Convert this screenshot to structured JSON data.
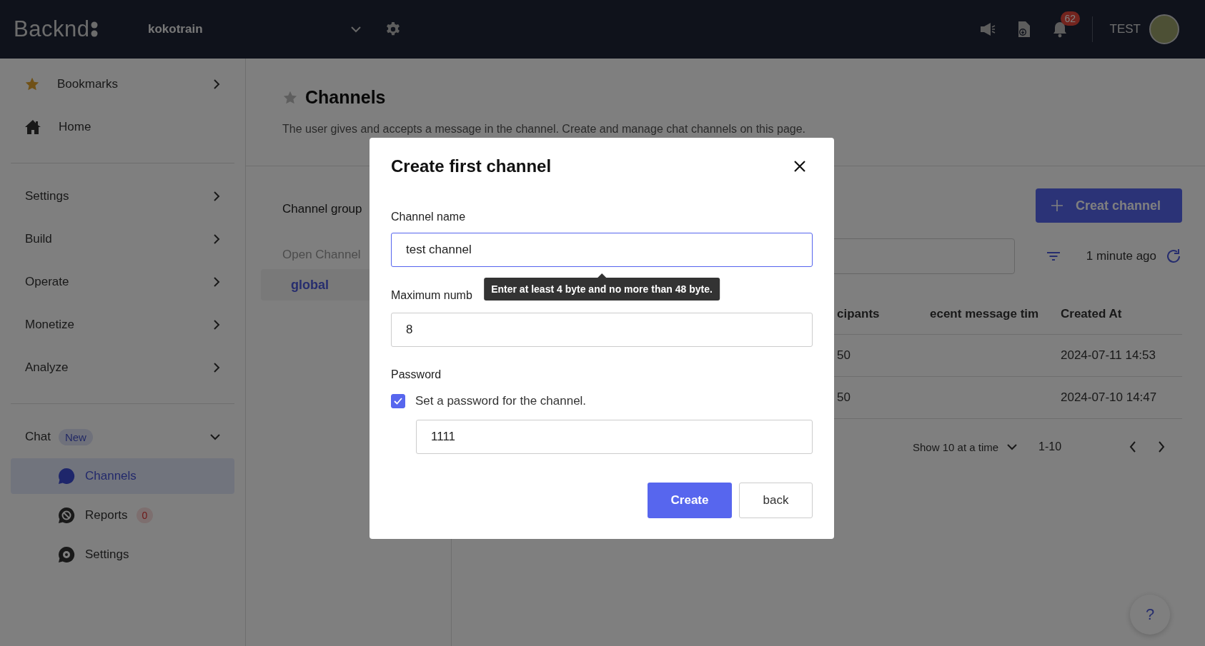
{
  "topbar": {
    "logo": "Backnd",
    "project": "kokotrain",
    "notification_count": "62",
    "user": "TEST"
  },
  "sidebar": {
    "groups": [
      {
        "items": [
          {
            "kind": "menu",
            "label": "Bookmarks",
            "expanded": false
          },
          {
            "kind": "link",
            "label": "Home"
          }
        ]
      },
      {
        "items": [
          {
            "kind": "menu",
            "label": "Settings",
            "expanded": false
          },
          {
            "kind": "menu",
            "label": "Build",
            "expanded": false
          },
          {
            "kind": "menu",
            "label": "Operate",
            "expanded": false
          },
          {
            "kind": "menu",
            "label": "Monetize",
            "expanded": false
          },
          {
            "kind": "menu",
            "label": "Analyze",
            "expanded": false
          }
        ]
      },
      {
        "items": [
          {
            "kind": "menu",
            "label": "Chat",
            "badge": "New",
            "expanded": true,
            "children": [
              {
                "label": "Channels",
                "selected": true
              },
              {
                "label": "Reports",
                "badge": "0",
                "selected": false
              },
              {
                "label": "Settings",
                "selected": false
              }
            ]
          }
        ]
      }
    ]
  },
  "page": {
    "title": "Channels",
    "description": "The user gives and accepts a message in the channel. Create and manage chat channels on this page."
  },
  "channel_groups": {
    "label": "Channel group",
    "heading": "Open Channel",
    "items": [
      {
        "label": "global",
        "selected": true
      }
    ]
  },
  "toolbar": {
    "create_button": "Creat channel",
    "updated": "1 minute ago"
  },
  "table": {
    "columns": [
      "cipants",
      "ecent message tim",
      "Created At"
    ],
    "rows": [
      {
        "cells": [
          "50",
          null,
          "2024-07-11 14:53"
        ]
      },
      {
        "cells": [
          "50",
          null,
          "2024-07-10 14:47"
        ]
      }
    ]
  },
  "pagination": {
    "page_size": "Show 10 at a time",
    "range": "1-10"
  },
  "help_button": "?",
  "modal": {
    "title": "Create first channel",
    "channel_name": {
      "label": "Channel name",
      "value": "test channel",
      "focused": true,
      "tooltip": "Enter at least 4 byte and no more than 48 byte."
    },
    "max_participants": {
      "label": "Maximum numb",
      "value": "8",
      "focused": false
    },
    "password": {
      "label": "Password",
      "checkbox_label": "Set a password for the channel.",
      "checked": true,
      "value": "1111",
      "focused": false
    },
    "buttons": [
      {
        "label": "Create",
        "kind": "primary"
      },
      {
        "label": "back",
        "kind": "secondary"
      }
    ]
  }
}
